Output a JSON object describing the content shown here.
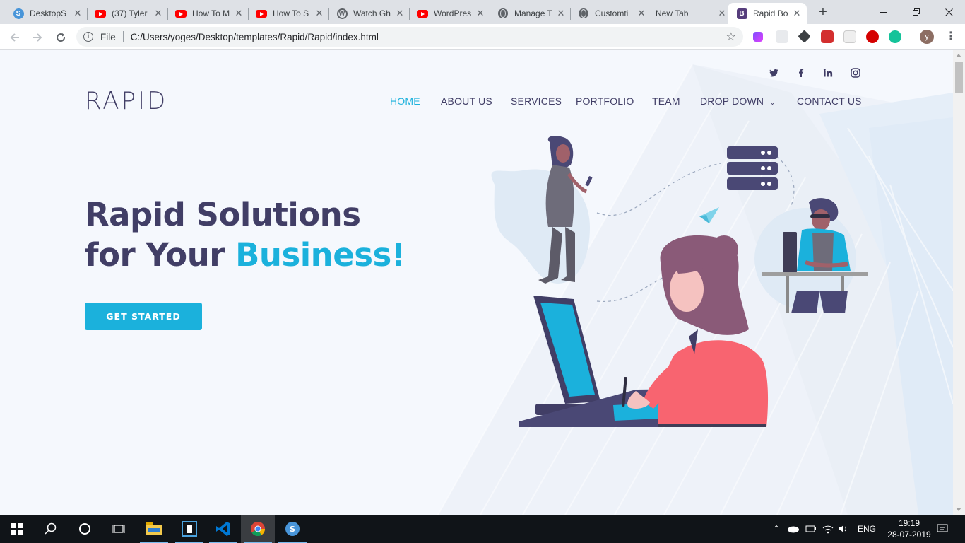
{
  "browser": {
    "tabs": [
      {
        "title": "DesktopS",
        "icon": "simplenote-icon"
      },
      {
        "title": "(37) Tyler",
        "icon": "youtube-icon"
      },
      {
        "title": "How To M",
        "icon": "youtube-icon"
      },
      {
        "title": "How To S",
        "icon": "youtube-icon"
      },
      {
        "title": "Watch Gh",
        "icon": "wordpress-icon"
      },
      {
        "title": "WordPres",
        "icon": "youtube-icon"
      },
      {
        "title": "Manage T",
        "icon": "globe-icon"
      },
      {
        "title": "Customti",
        "icon": "globe-icon"
      },
      {
        "title": "New Tab",
        "icon": ""
      },
      {
        "title": "Rapid Bo",
        "icon": "bootstrap-icon",
        "active": true
      }
    ],
    "new_tab_symbol": "+",
    "scheme_label": "File",
    "url": "C:/Users/yoges/Desktop/templates/Rapid/Rapid/index.html",
    "profile_initial": "y"
  },
  "site": {
    "logo": "RAPID",
    "social": [
      "twitter-icon",
      "facebook-icon",
      "linkedin-icon",
      "instagram-icon"
    ],
    "nav": [
      {
        "label": "HOME",
        "active": true
      },
      {
        "label": "ABOUT US"
      },
      {
        "label": "SERVICES"
      },
      {
        "label": "PORTFOLIO"
      },
      {
        "label": "TEAM"
      },
      {
        "label": "DROP DOWN",
        "has_caret": true
      },
      {
        "label": "CONTACT US"
      }
    ],
    "hero": {
      "line1": "Rapid Solutions",
      "line2_prefix": "for Your ",
      "line2_accent": "Business!"
    },
    "cta_label": "GET STARTED",
    "colors": {
      "primary": "#413e66",
      "accent": "#1bb1dc",
      "background": "#f5f8fd",
      "illustration_shirt": "#f86470"
    }
  },
  "taskbar": {
    "apps": [
      "windows-start-icon",
      "search-icon",
      "cortana-icon",
      "task-view-icon",
      "file-explorer-icon",
      "app-icon",
      "vscode-icon",
      "chrome-icon",
      "simplenote-icon"
    ],
    "language": "ENG",
    "time": "19:19",
    "date": "28-07-2019"
  }
}
